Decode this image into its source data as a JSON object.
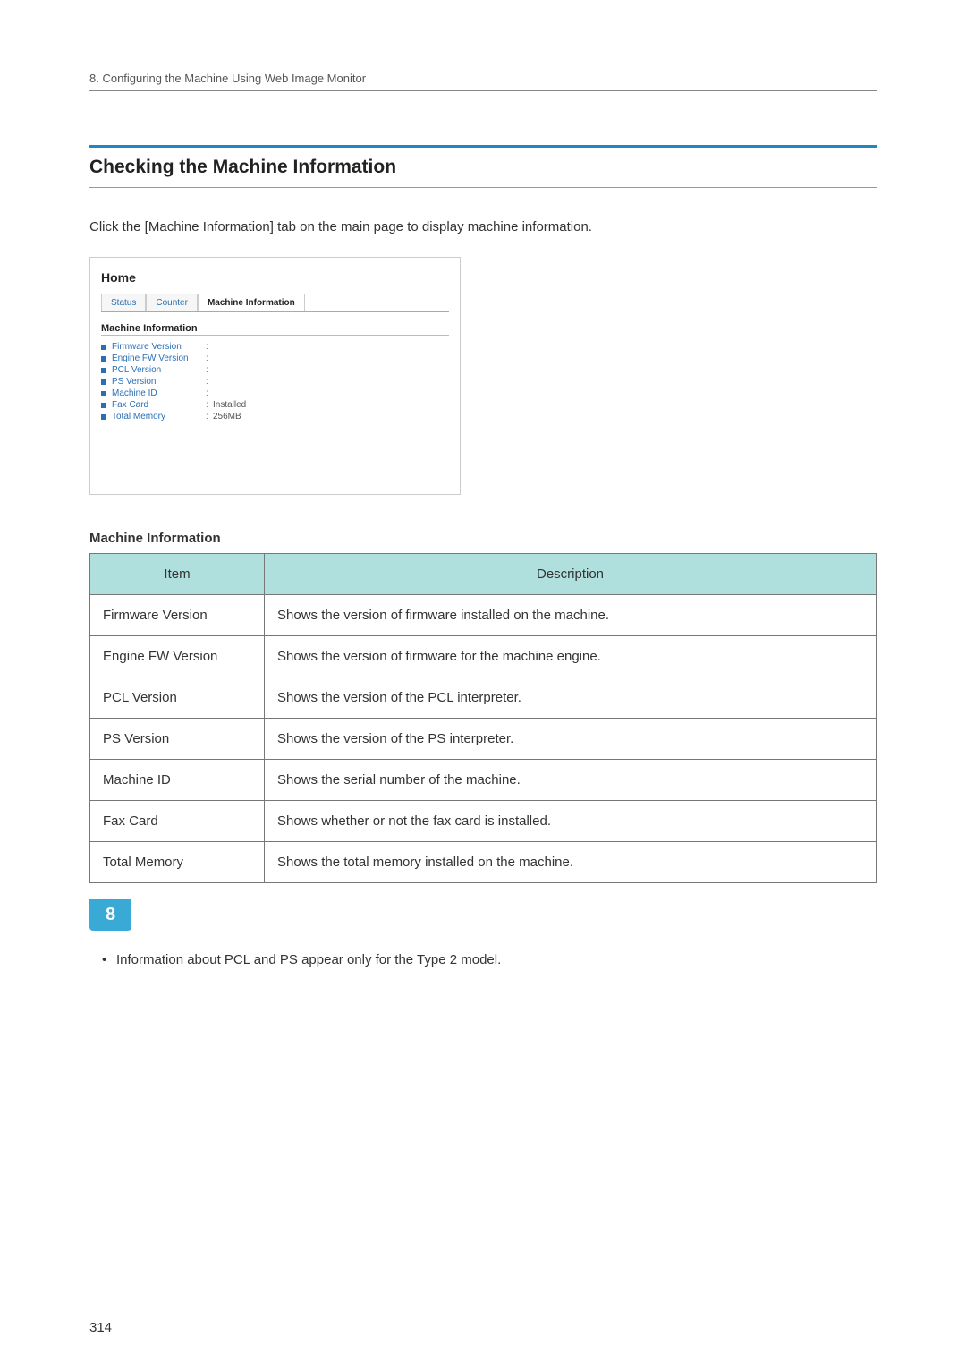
{
  "header": {
    "chapter_line": "8. Configuring the Machine Using Web Image Monitor"
  },
  "section": {
    "title": "Checking the Machine Information",
    "intro": "Click the [Machine Information] tab on the main page to display machine information."
  },
  "screenshot": {
    "home": "Home",
    "tabs": {
      "status": "Status",
      "counter": "Counter",
      "machine_info": "Machine Information"
    },
    "section_header": "Machine Information",
    "rows": [
      {
        "label": "Firmware Version",
        "sep": ":",
        "val": ""
      },
      {
        "label": "Engine FW Version",
        "sep": ":",
        "val": ""
      },
      {
        "label": "PCL Version",
        "sep": ":",
        "val": ""
      },
      {
        "label": "PS Version",
        "sep": ":",
        "val": ""
      },
      {
        "label": "Machine ID",
        "sep": ":",
        "val": ""
      },
      {
        "label": "Fax Card",
        "sep": ":",
        "val": "Installed"
      },
      {
        "label": "Total Memory",
        "sep": ":",
        "val": "256MB"
      }
    ]
  },
  "table": {
    "title": "Machine Information",
    "headers": {
      "item": "Item",
      "description": "Description"
    },
    "rows": [
      {
        "item": "Firmware Version",
        "desc": "Shows the version of firmware installed on the machine."
      },
      {
        "item": "Engine FW Version",
        "desc": "Shows the version of firmware for the machine engine."
      },
      {
        "item": "PCL Version",
        "desc": "Shows the version of the PCL interpreter."
      },
      {
        "item": "PS Version",
        "desc": "Shows the version of the PS interpreter."
      },
      {
        "item": "Machine ID",
        "desc": "Shows the serial number of the machine."
      },
      {
        "item": "Fax Card",
        "desc": "Shows whether or not the fax card is installed."
      },
      {
        "item": "Total Memory",
        "desc": "Shows the total memory installed on the machine."
      }
    ]
  },
  "chapter_tab": "8",
  "note": "Information about PCL and PS appear only for the Type 2 model.",
  "page_number": "314"
}
